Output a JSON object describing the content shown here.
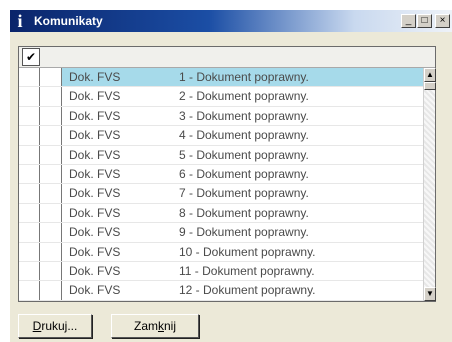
{
  "window": {
    "title": "Komunikaty",
    "title_icon": "info-icon",
    "controls": {
      "minimize": "_",
      "maximize": "□",
      "close": "×"
    }
  },
  "grid": {
    "header_icon": "check-icon",
    "selected_row": 0,
    "rows": [
      {
        "doc": "Dok. FVS",
        "message": "1 - Dokument poprawny."
      },
      {
        "doc": "Dok. FVS",
        "message": "2 - Dokument poprawny."
      },
      {
        "doc": "Dok. FVS",
        "message": "3 - Dokument poprawny."
      },
      {
        "doc": "Dok. FVS",
        "message": "4 - Dokument poprawny."
      },
      {
        "doc": "Dok. FVS",
        "message": "5 - Dokument poprawny."
      },
      {
        "doc": "Dok. FVS",
        "message": "6 - Dokument poprawny."
      },
      {
        "doc": "Dok. FVS",
        "message": "7 - Dokument poprawny."
      },
      {
        "doc": "Dok. FVS",
        "message": "8 - Dokument poprawny."
      },
      {
        "doc": "Dok. FVS",
        "message": "9 - Dokument poprawny."
      },
      {
        "doc": "Dok. FVS",
        "message": "10 - Dokument poprawny."
      },
      {
        "doc": "Dok. FVS",
        "message": "11 - Dokument poprawny."
      },
      {
        "doc": "Dok. FVS",
        "message": "12 - Dokument poprawny."
      }
    ]
  },
  "buttons": {
    "print": {
      "mnemonic": "D",
      "rest": "rukuj..."
    },
    "close": {
      "pre": "Zam",
      "mnemonic": "k",
      "post": "nij"
    }
  },
  "colors": {
    "titlebar_start": "#0a246a",
    "selected_row": "#a6daea",
    "dialog_bg": "#ece9d8"
  }
}
